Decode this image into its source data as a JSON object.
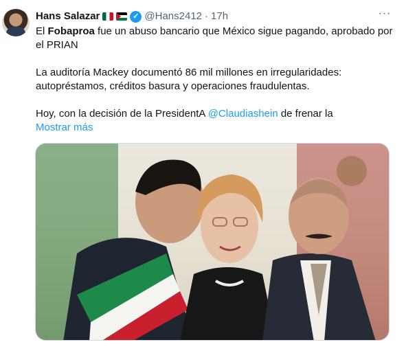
{
  "author": {
    "name": "Hans Salazar",
    "handle": "@Hans2412",
    "separator": "·",
    "time": "17h"
  },
  "more_menu": "···",
  "tweet": {
    "line1_pre": "El ",
    "line1_bold": "Fobaproa",
    "line1_post": " fue un abuso bancario que México sigue pagando, aprobado por el PRIAN",
    "para2": "La auditoría Mackey documentó 86 mil millones en irregularidades: autopréstamos, créditos basura y operaciones fraudulentas.",
    "para3_pre": "Hoy, con la decisión de la PresidentA ",
    "para3_mention": "@Claudiashein",
    "para3_post": " de frenar la",
    "show_more": "Mostrar más"
  },
  "colors": {
    "link": "#1d9bf0",
    "text": "#0f1419",
    "muted": "#536471",
    "verified": "#1d9bf0"
  },
  "icons": {
    "verified": "verified-badge-icon",
    "flag_1": "mexico-flag-icon",
    "flag_2": "palestine-flag-icon",
    "more": "more-options-icon"
  }
}
